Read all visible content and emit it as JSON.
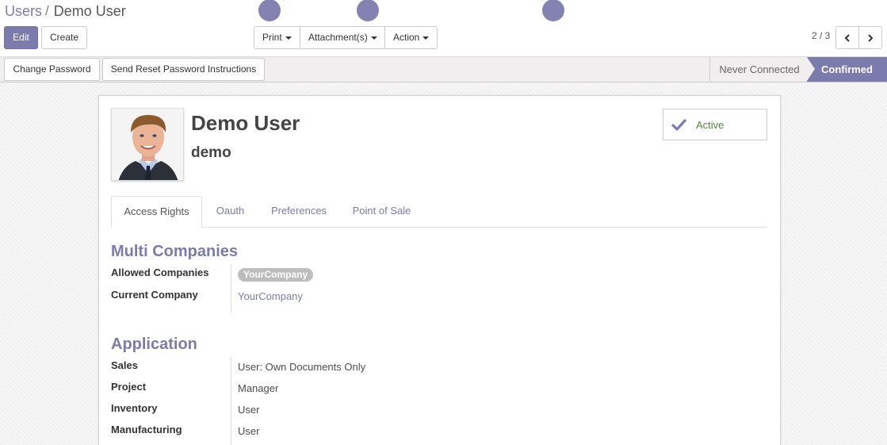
{
  "breadcrumb": {
    "parent": "Users",
    "separator": "/",
    "current": "Demo User"
  },
  "toolbar": {
    "edit_label": "Edit",
    "create_label": "Create",
    "print_label": "Print",
    "attachments_label": "Attachment(s)",
    "action_label": "Action"
  },
  "pager": {
    "value": "2 / 3"
  },
  "statusbar": {
    "change_password_label": "Change Password",
    "reset_password_label": "Send Reset Password Instructions",
    "stages": [
      "Never Connected",
      "Confirmed"
    ],
    "current_stage": "Confirmed"
  },
  "user": {
    "name": "Demo User",
    "login": "demo",
    "active_label": "Active"
  },
  "tabs": [
    {
      "label": "Access Rights",
      "active": true
    },
    {
      "label": "Oauth",
      "active": false
    },
    {
      "label": "Preferences",
      "active": false
    },
    {
      "label": "Point of Sale",
      "active": false
    }
  ],
  "multi_companies": {
    "title": "Multi Companies",
    "allowed_label": "Allowed Companies",
    "allowed_tag": "YourCompany",
    "current_label": "Current Company",
    "current_value": "YourCompany"
  },
  "application": {
    "title": "Application",
    "rows": [
      {
        "label": "Sales",
        "value": "User: Own Documents Only"
      },
      {
        "label": "Project",
        "value": "Manager"
      },
      {
        "label": "Inventory",
        "value": "User"
      },
      {
        "label": "Manufacturing",
        "value": "User"
      }
    ]
  },
  "colors": {
    "brand": "#7c7bad",
    "active": "#4c8a3c"
  },
  "icons": {
    "prev": "chevron-left-icon",
    "next": "chevron-right-icon",
    "active": "check-icon"
  }
}
